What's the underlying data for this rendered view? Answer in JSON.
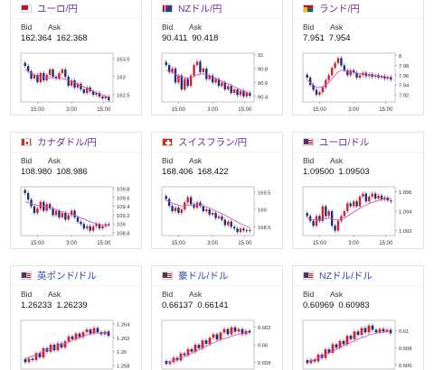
{
  "quote_cards": [
    {
      "pair": "ユーロ/円",
      "name_color": "purple",
      "flag": "eu-flag-icon",
      "bid_label": "Bid",
      "ask_label": "Ask",
      "bid": "162.364",
      "ask": "162.368",
      "chart_data": {
        "type": "candlestick",
        "y_ticks": [
          "163.5",
          "163",
          "162.5"
        ],
        "ylim": [
          162.3,
          163.65
        ],
        "x_ticks": [
          "15:00",
          "3:00",
          "15:00"
        ],
        "closes": [
          163.3,
          163.15,
          162.95,
          163.05,
          162.85,
          163.1,
          162.9,
          163.05,
          163.2,
          163.0,
          162.95,
          163.1,
          163.2,
          163.0,
          162.75,
          162.9,
          162.7,
          162.8,
          162.65,
          162.55,
          162.7,
          162.6,
          162.5,
          162.55,
          162.45,
          162.4,
          162.45,
          162.35
        ],
        "ma": [
          163.2,
          163.15,
          163.1,
          163.05,
          163.02,
          163.0,
          162.98,
          162.97,
          162.97,
          162.97,
          162.96,
          162.95,
          162.95,
          162.93,
          162.9,
          162.87,
          162.84,
          162.8,
          162.76,
          162.72,
          162.68,
          162.64,
          162.6,
          162.56,
          162.52,
          162.49,
          162.46,
          162.43
        ]
      }
    },
    {
      "pair": "NZドル/円",
      "name_color": "purple",
      "flag": "nz-flag-icon",
      "bid_label": "Bid",
      "ask_label": "Ask",
      "bid": "90.411",
      "ask": "90.418",
      "chart_data": {
        "type": "candlestick",
        "y_ticks": [
          "91",
          "90.8",
          "90.6",
          "90.4"
        ],
        "ylim": [
          90.32,
          91.02
        ],
        "x_ticks": [
          "15:00",
          "3:00",
          "15:00"
        ],
        "closes": [
          90.85,
          90.75,
          90.8,
          90.6,
          90.7,
          90.5,
          90.65,
          90.55,
          90.7,
          90.85,
          90.9,
          90.75,
          90.8,
          90.65,
          90.7,
          90.6,
          90.65,
          90.55,
          90.6,
          90.5,
          90.55,
          90.45,
          90.5,
          90.42,
          90.48,
          90.4,
          90.45,
          90.41
        ],
        "ma": [
          90.78,
          90.76,
          90.74,
          90.72,
          90.7,
          90.68,
          90.67,
          90.66,
          90.67,
          90.69,
          90.71,
          90.72,
          90.72,
          90.71,
          90.7,
          90.68,
          90.66,
          90.64,
          90.62,
          90.6,
          90.58,
          90.56,
          90.54,
          90.52,
          90.5,
          90.48,
          90.46,
          90.44
        ]
      }
    },
    {
      "pair": "ランド/円",
      "name_color": "purple",
      "flag": "za-flag-icon",
      "bid_label": "Bid",
      "ask_label": "Ask",
      "bid": "7.951",
      "ask": "7.954",
      "chart_data": {
        "type": "candlestick",
        "y_ticks": [
          "8",
          "7.98",
          "7.96",
          "7.94",
          "7.92"
        ],
        "ylim": [
          7.905,
          8.005
        ],
        "x_ticks": [
          "15:00",
          "3:00",
          "15:00"
        ],
        "closes": [
          7.955,
          7.94,
          7.93,
          7.92,
          7.925,
          7.935,
          7.95,
          7.96,
          7.975,
          7.985,
          7.995,
          7.98,
          7.97,
          7.96,
          7.97,
          7.965,
          7.955,
          7.96,
          7.965,
          7.958,
          7.962,
          7.957,
          7.96,
          7.955,
          7.958,
          7.953,
          7.956,
          7.951
        ],
        "ma": [
          7.95,
          7.945,
          7.94,
          7.935,
          7.935,
          7.936,
          7.94,
          7.945,
          7.952,
          7.96,
          7.967,
          7.97,
          7.97,
          7.968,
          7.967,
          7.966,
          7.964,
          7.963,
          7.962,
          7.961,
          7.96,
          7.959,
          7.959,
          7.958,
          7.958,
          7.957,
          7.956,
          7.955
        ]
      }
    },
    {
      "pair": "カナダドル/円",
      "name_color": "purple",
      "flag": "ca-flag-icon",
      "bid_label": "Bid",
      "ask_label": "Ask",
      "bid": "108.980",
      "ask": "108.986",
      "chart_data": {
        "type": "candlestick",
        "y_ticks": [
          "109.8",
          "109.6",
          "109.4",
          "109.2",
          "109",
          "108.8"
        ],
        "ylim": [
          108.74,
          109.84
        ],
        "x_ticks": [
          "15:00",
          "3:00",
          "15:00"
        ],
        "closes": [
          109.7,
          109.55,
          109.4,
          109.25,
          109.35,
          109.5,
          109.3,
          109.45,
          109.35,
          109.2,
          109.3,
          109.15,
          109.25,
          109.1,
          109.2,
          109.3,
          109.15,
          109.05,
          109.0,
          108.9,
          108.95,
          108.85,
          108.95,
          109.0,
          108.9,
          108.95,
          109.0,
          108.98
        ],
        "ma": [
          109.5,
          109.48,
          109.46,
          109.44,
          109.42,
          109.41,
          109.4,
          109.39,
          109.37,
          109.35,
          109.33,
          109.3,
          109.28,
          109.26,
          109.24,
          109.22,
          109.2,
          109.17,
          109.14,
          109.11,
          109.08,
          109.05,
          109.03,
          109.01,
          108.99,
          108.98,
          108.97,
          108.96
        ]
      }
    },
    {
      "pair": "スイスフラン/円",
      "name_color": "purple",
      "flag": "ch-flag-icon",
      "bid_label": "Bid",
      "ask_label": "Ask",
      "bid": "168.406",
      "ask": "168.422",
      "chart_data": {
        "type": "candlestick",
        "y_ticks": [
          "169.5",
          "169",
          "168.5"
        ],
        "ylim": [
          168.25,
          169.65
        ],
        "x_ticks": [
          "15:00",
          "3:00",
          "15:00"
        ],
        "closes": [
          169.3,
          169.1,
          168.95,
          169.05,
          168.9,
          169.0,
          169.2,
          169.35,
          169.15,
          169.05,
          169.2,
          169.1,
          168.95,
          169.0,
          168.85,
          168.9,
          168.75,
          168.8,
          168.7,
          168.55,
          168.65,
          168.5,
          168.45,
          168.35,
          168.45,
          168.4,
          168.38,
          168.41
        ],
        "ma": [
          169.25,
          169.22,
          169.18,
          169.15,
          169.12,
          169.1,
          169.1,
          169.12,
          169.13,
          169.12,
          169.12,
          169.11,
          169.09,
          169.07,
          169.04,
          169.0,
          168.96,
          168.92,
          168.88,
          168.83,
          168.79,
          168.74,
          168.69,
          168.64,
          168.59,
          168.55,
          168.51,
          168.48
        ]
      }
    },
    {
      "pair": "ユーロ/ドル",
      "name_color": "purple",
      "flag": "us-flag-icon",
      "bid_label": "Bid",
      "ask_label": "Ask",
      "bid": "1.09500",
      "ask": "1.09503",
      "chart_data": {
        "type": "candlestick",
        "y_ticks": [
          "1.096",
          "1.094",
          "1.092"
        ],
        "ylim": [
          1.0915,
          1.0965
        ],
        "x_ticks": [
          "15:00",
          "3:00",
          "15:00"
        ],
        "closes": [
          1.0935,
          1.093,
          1.0925,
          1.0935,
          1.093,
          1.0945,
          1.0935,
          1.094,
          1.0925,
          1.092,
          1.093,
          1.0935,
          1.094,
          1.0948,
          1.0945,
          1.095,
          1.0945,
          1.0955,
          1.0958,
          1.095,
          1.0955,
          1.0958,
          1.0953,
          1.0956,
          1.0952,
          1.0954,
          1.0951,
          1.095
        ],
        "ma": [
          1.0932,
          1.0932,
          1.0931,
          1.0931,
          1.0931,
          1.0932,
          1.0932,
          1.0933,
          1.0932,
          1.0931,
          1.0931,
          1.0932,
          1.0933,
          1.0935,
          1.0937,
          1.0939,
          1.0941,
          1.0943,
          1.0945,
          1.0946,
          1.0948,
          1.0949,
          1.095,
          1.0951,
          1.0952,
          1.0952,
          1.0953,
          1.0953
        ]
      }
    },
    {
      "pair": "英ポンド/ドル",
      "name_color": "blue",
      "flag": "us-flag-icon",
      "bid_label": "Bid",
      "ask_label": "Ask",
      "bid": "1.26233",
      "ask": "1.26239",
      "chart_data": {
        "type": "candlestick",
        "y_ticks": [
          "1.264",
          "1.262",
          "1.26",
          "1.258"
        ],
        "ylim": [
          1.2575,
          1.2645
        ],
        "x_ticks": [],
        "closes": [
          1.2585,
          1.259,
          1.2588,
          1.2598,
          1.2592,
          1.2605,
          1.26,
          1.261,
          1.2602,
          1.2612,
          1.2606,
          1.2615,
          1.2622,
          1.2618,
          1.2626,
          1.2621,
          1.2628,
          1.2632,
          1.2626,
          1.2634,
          1.2628,
          1.2625,
          1.2629,
          1.2623
        ],
        "ma": [
          1.259,
          1.2592,
          1.2594,
          1.2596,
          1.2598,
          1.2601,
          1.2603,
          1.2605,
          1.2606,
          1.2608,
          1.261,
          1.2612,
          1.2614,
          1.2616,
          1.2618,
          1.262,
          1.2622,
          1.2624,
          1.2625,
          1.2627,
          1.2627,
          1.2627,
          1.2628,
          1.2627
        ]
      }
    },
    {
      "pair": "豪ドル/ドル",
      "name_color": "blue",
      "flag": "us-flag-icon",
      "bid_label": "Bid",
      "ask_label": "Ask",
      "bid": "0.66137",
      "ask": "0.66141",
      "chart_data": {
        "type": "candlestick",
        "y_ticks": [
          "0.662",
          "0.66",
          "0.658"
        ],
        "ylim": [
          0.6572,
          0.6628
        ],
        "x_ticks": [],
        "closes": [
          0.6578,
          0.658,
          0.6585,
          0.6582,
          0.659,
          0.6588,
          0.6595,
          0.6592,
          0.66,
          0.6596,
          0.6605,
          0.6601,
          0.6608,
          0.6612,
          0.6606,
          0.6614,
          0.6618,
          0.6612,
          0.662,
          0.6615,
          0.6618,
          0.6612,
          0.6616,
          0.6614
        ],
        "ma": [
          0.658,
          0.6581,
          0.6582,
          0.6583,
          0.6585,
          0.6586,
          0.6588,
          0.659,
          0.6592,
          0.6594,
          0.6596,
          0.6598,
          0.66,
          0.6602,
          0.6604,
          0.6606,
          0.6607,
          0.6608,
          0.661,
          0.6611,
          0.6612,
          0.6613,
          0.6614,
          0.6614
        ]
      }
    },
    {
      "pair": "NZドル/ドル",
      "name_color": "blue",
      "flag": "us-flag-icon",
      "bid_label": "Bid",
      "ask_label": "Ask",
      "bid": "0.60969",
      "ask": "0.60983",
      "chart_data": {
        "type": "candlestick",
        "y_ticks": [
          "0.61",
          "0.608",
          "0.606"
        ],
        "ylim": [
          0.6055,
          0.6112
        ],
        "x_ticks": [],
        "closes": [
          0.6062,
          0.6066,
          0.6064,
          0.6072,
          0.6068,
          0.6078,
          0.6074,
          0.6084,
          0.608,
          0.6088,
          0.6084,
          0.6094,
          0.609,
          0.6099,
          0.6095,
          0.6103,
          0.6098,
          0.6106,
          0.6101,
          0.6098,
          0.6102,
          0.6099,
          0.6101,
          0.6097
        ],
        "ma": [
          0.6064,
          0.6065,
          0.6066,
          0.6068,
          0.607,
          0.6072,
          0.6074,
          0.6076,
          0.6078,
          0.608,
          0.6082,
          0.6084,
          0.6086,
          0.6088,
          0.609,
          0.6092,
          0.6093,
          0.6095,
          0.6096,
          0.6097,
          0.6098,
          0.6098,
          0.6099,
          0.6099
        ]
      }
    }
  ]
}
